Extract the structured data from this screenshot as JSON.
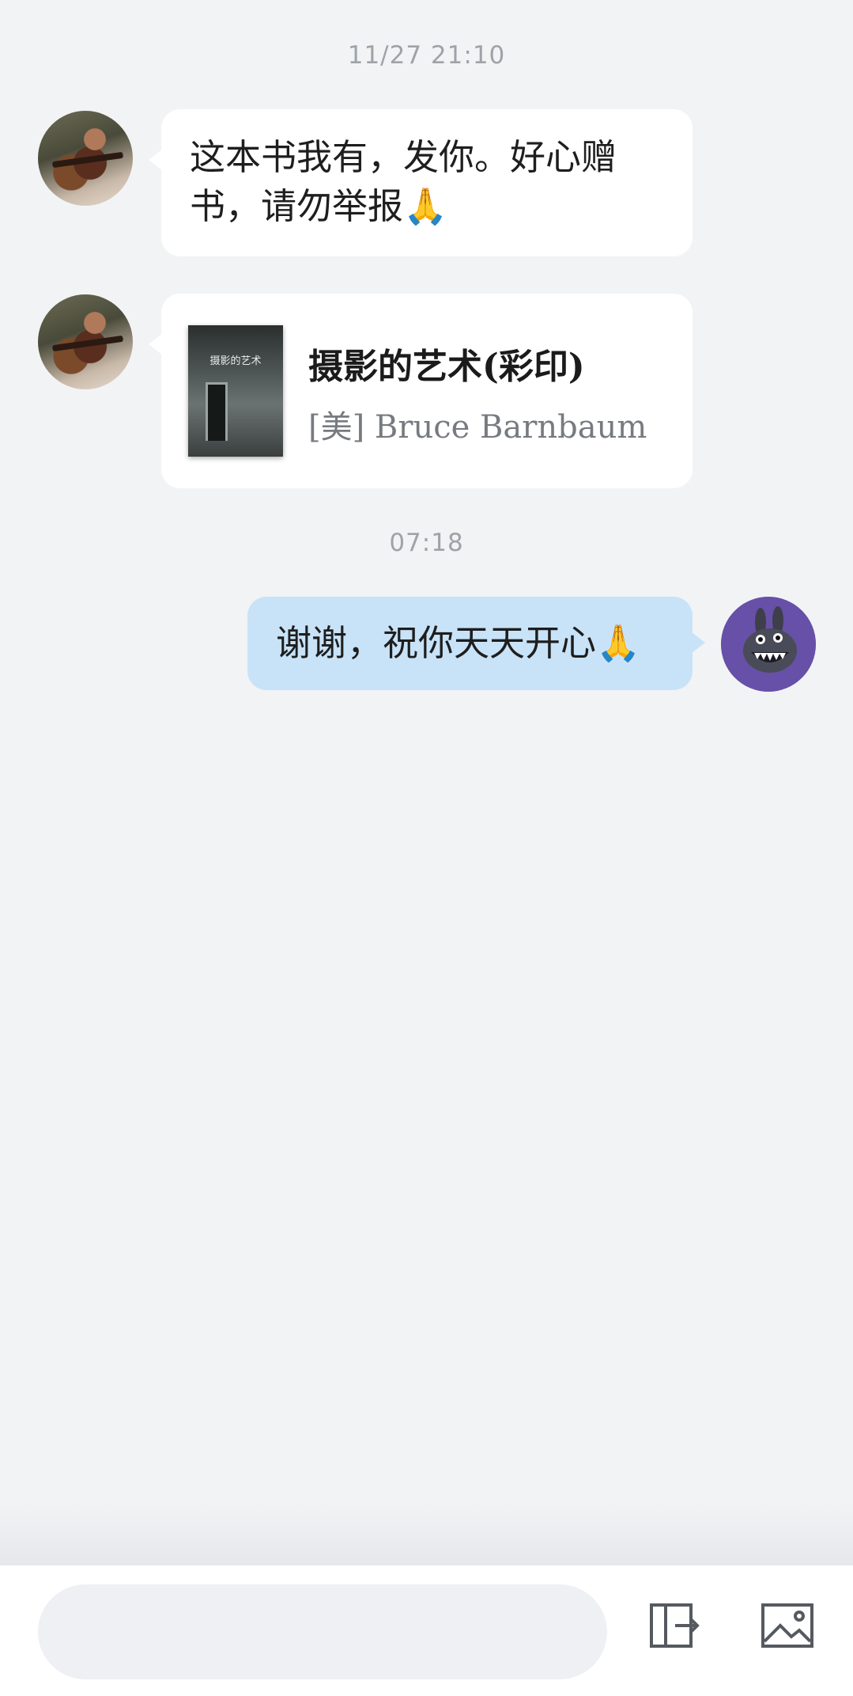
{
  "messages": [
    {
      "type": "timestamp",
      "text": "11/27 21:10"
    },
    {
      "type": "text",
      "side": "left",
      "text": "这本书我有，发你。好心赠书，请勿举报🙏"
    },
    {
      "type": "book",
      "side": "left",
      "title": "摄影的艺术(彩印)",
      "author": "[美] Bruce Barnbaum",
      "cover_title": "摄影的艺术"
    },
    {
      "type": "timestamp",
      "text": "07:18"
    },
    {
      "type": "text",
      "side": "right",
      "text": "谢谢，祝你天天开心🙏"
    }
  ],
  "composer": {
    "input_value": "",
    "placeholder": "",
    "icons": [
      "exit-panel-icon",
      "image-icon"
    ]
  },
  "colors": {
    "background": "#f2f3f5",
    "bubble_incoming": "#ffffff",
    "bubble_outgoing": "#c8e3f8",
    "timestamp": "#9ea3a8"
  }
}
